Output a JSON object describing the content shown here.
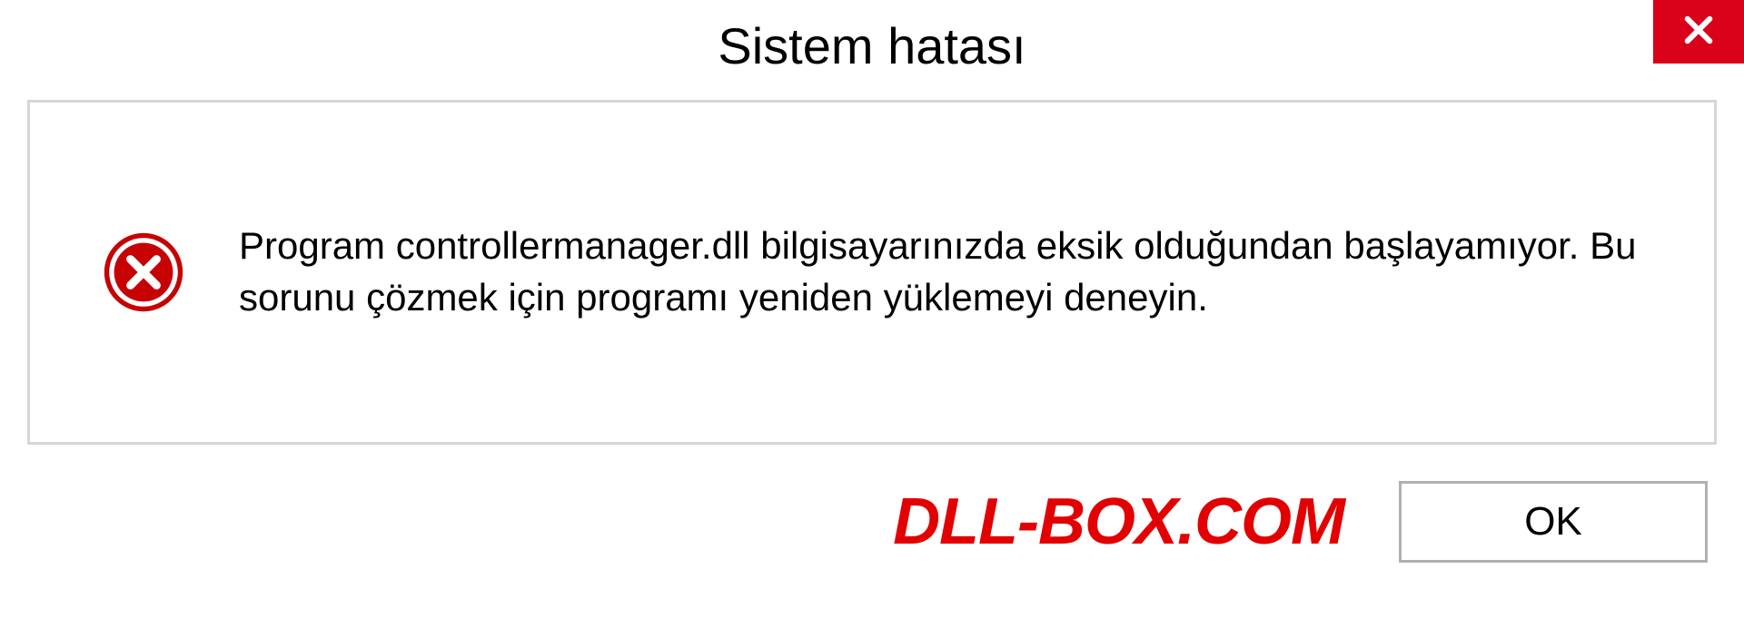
{
  "dialog": {
    "title": "Sistem hatası",
    "message": "Program controllermanager.dll bilgisayarınızda eksik olduğundan başlayamıyor. Bu sorunu çözmek için programı yeniden yüklemeyi deneyin.",
    "ok_label": "OK"
  },
  "watermark": "DLL-BOX.COM",
  "colors": {
    "close_bg": "#d9021a",
    "error_icon": "#c70202",
    "watermark": "#e20000",
    "border": "#d6d6d6"
  }
}
